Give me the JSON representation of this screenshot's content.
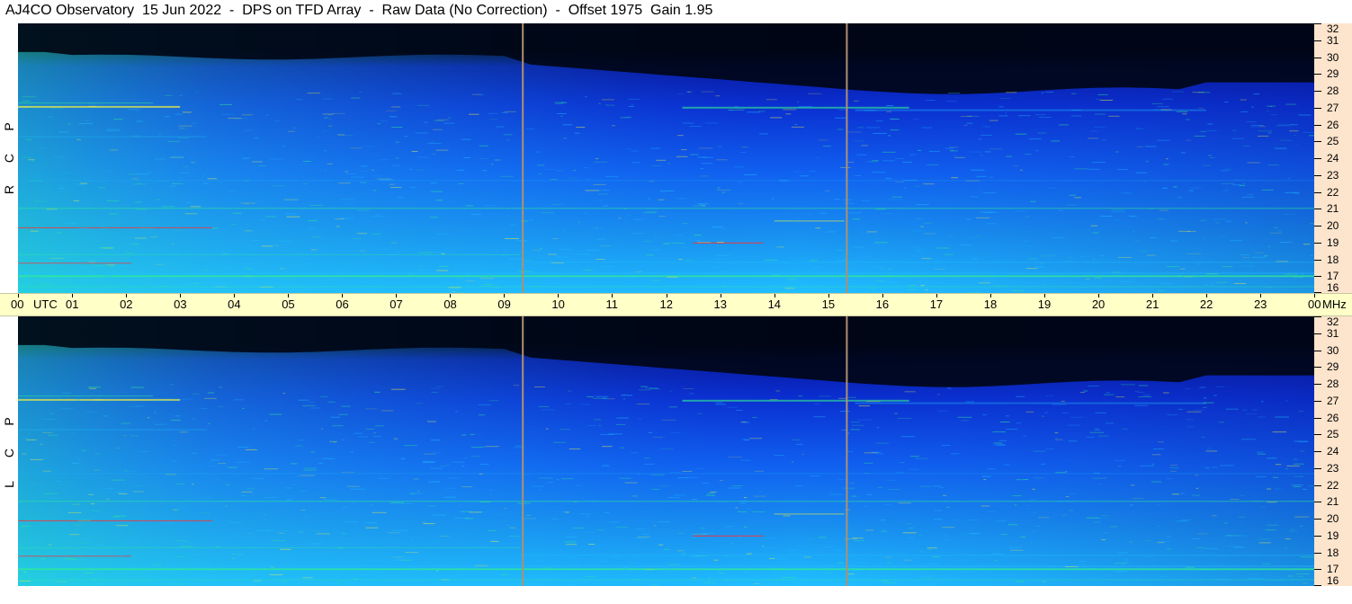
{
  "title": "AJ4CO Observatory  15 Jun 2022  -  DPS on TFD Array  -  Raw Data (No Correction)  -  Offset 1975  Gain 1.95",
  "panels": [
    {
      "id": "top",
      "letters": [
        "R",
        "C",
        "P"
      ]
    },
    {
      "id": "bottom",
      "letters": [
        "L",
        "C",
        "P"
      ]
    }
  ],
  "time_axis": {
    "unit_label": "UTC",
    "end_unit_label": "MHz",
    "ticks": [
      "00",
      "01",
      "02",
      "03",
      "04",
      "05",
      "06",
      "07",
      "08",
      "09",
      "10",
      "11",
      "12",
      "13",
      "14",
      "15",
      "16",
      "17",
      "18",
      "19",
      "20",
      "21",
      "22",
      "23",
      "00"
    ]
  },
  "chart_data": {
    "type": "heatmap",
    "title": "AJ4CO Observatory  15 Jun 2022  -  DPS on TFD Array  -  Raw Data (No Correction)  -  Offset 1975  Gain 1.95",
    "x_range_hours_utc": [
      0,
      24
    ],
    "y_range_mhz": [
      16,
      32
    ],
    "y_ticks": [
      32,
      31,
      30,
      29,
      28,
      27,
      26,
      25,
      24,
      23,
      22,
      21,
      20,
      19,
      18,
      17,
      16
    ],
    "series": [
      {
        "name": "RCP"
      },
      {
        "name": "LCP"
      }
    ],
    "markers_utc": [
      9.33,
      15.33
    ],
    "colors": {
      "background_dark": "#000820",
      "deep_blue": "#0a2ed0",
      "mid_blue": "#1060f0",
      "cyan": "#20c0ff",
      "green": "#30f090",
      "yellow": "#f0f040",
      "red": "#ff3030",
      "marker_line": "#b09070"
    }
  }
}
